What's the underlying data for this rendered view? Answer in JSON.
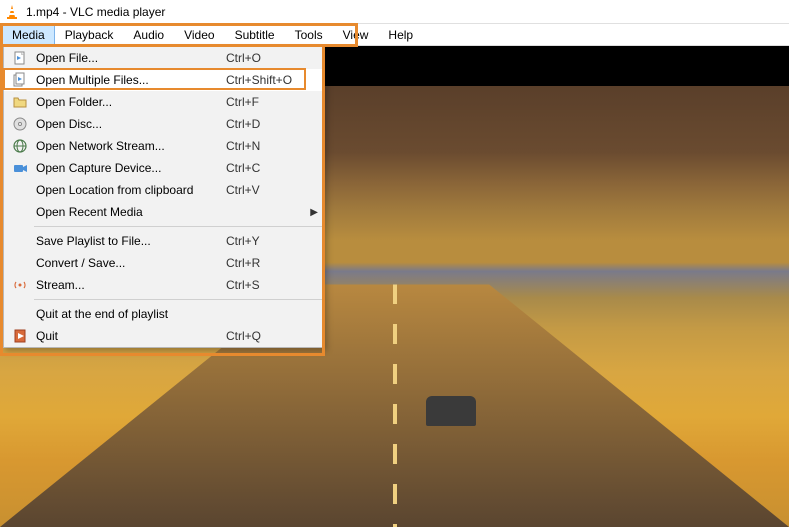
{
  "titlebar": {
    "title": "1.mp4 - VLC media player"
  },
  "menubar": {
    "items": [
      {
        "label": "Media",
        "active": true
      },
      {
        "label": "Playback"
      },
      {
        "label": "Audio"
      },
      {
        "label": "Video"
      },
      {
        "label": "Subtitle"
      },
      {
        "label": "Tools"
      },
      {
        "label": "View"
      },
      {
        "label": "Help"
      }
    ]
  },
  "dropdown": {
    "items": [
      {
        "icon": "file-icon",
        "label": "Open File...",
        "shortcut": "Ctrl+O"
      },
      {
        "icon": "file-multi-icon",
        "label": "Open Multiple Files...",
        "shortcut": "Ctrl+Shift+O",
        "highlighted": true
      },
      {
        "icon": "folder-icon",
        "label": "Open Folder...",
        "shortcut": "Ctrl+F"
      },
      {
        "icon": "disc-icon",
        "label": "Open Disc...",
        "shortcut": "Ctrl+D"
      },
      {
        "icon": "network-icon",
        "label": "Open Network Stream...",
        "shortcut": "Ctrl+N"
      },
      {
        "icon": "capture-icon",
        "label": "Open Capture Device...",
        "shortcut": "Ctrl+C"
      },
      {
        "icon": "",
        "label": "Open Location from clipboard",
        "shortcut": "Ctrl+V"
      },
      {
        "icon": "",
        "label": "Open Recent Media",
        "shortcut": "",
        "submenu": true
      },
      {
        "sep": true
      },
      {
        "icon": "",
        "label": "Save Playlist to File...",
        "shortcut": "Ctrl+Y"
      },
      {
        "icon": "",
        "label": "Convert / Save...",
        "shortcut": "Ctrl+R"
      },
      {
        "icon": "stream-icon",
        "label": "Stream...",
        "shortcut": "Ctrl+S"
      },
      {
        "sep": true
      },
      {
        "icon": "",
        "label": "Quit at the end of playlist",
        "shortcut": ""
      },
      {
        "icon": "quit-icon",
        "label": "Quit",
        "shortcut": "Ctrl+Q"
      }
    ]
  }
}
